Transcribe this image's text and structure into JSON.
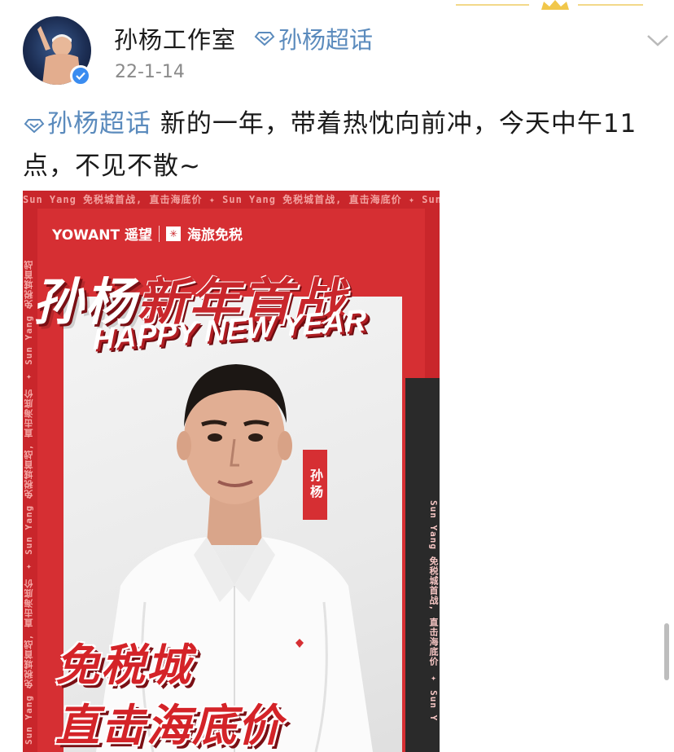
{
  "post": {
    "author": "孙杨工作室",
    "author_topic": "孙杨超话",
    "date": "22-1-14",
    "topic": "孙杨超话",
    "text": " 新的一年，带着热忱向前冲，今天中午11点，不见不散~"
  },
  "poster": {
    "marquee": "Sun Yang 免税城首战, 直击海底价 ✦ Sun Yang 免税城首战, 直击海底价 ✦ Sun Yang 免税城首战, 直击海底价",
    "side_left": "Sun Yang 免税城首战, 直击海底价 ✦ Sun Yang 免税城首战, 直击海底价 ✦ Sun Yang 免税城首战",
    "side_right": "Sun Yang 免税城首战, 直击海底价 ✦ Sun Y",
    "brand1": "YOWANT 遥望",
    "brand2": "海旅免税",
    "title_cn_1": "孙杨",
    "title_cn_2": "新年首战",
    "title_en": "HAPPY NEW YEAR",
    "name_tag": "孙杨",
    "slogan1": "免税城",
    "slogan2": "直击海底价"
  },
  "colors": {
    "topic_blue": "#5b8bbd",
    "poster_red": "#c9262b",
    "verified_blue": "#3a8cf0"
  },
  "icons": {
    "verified": "verified-badge-icon",
    "more": "chevron-down-icon",
    "topic": "diamond-topic-icon"
  }
}
